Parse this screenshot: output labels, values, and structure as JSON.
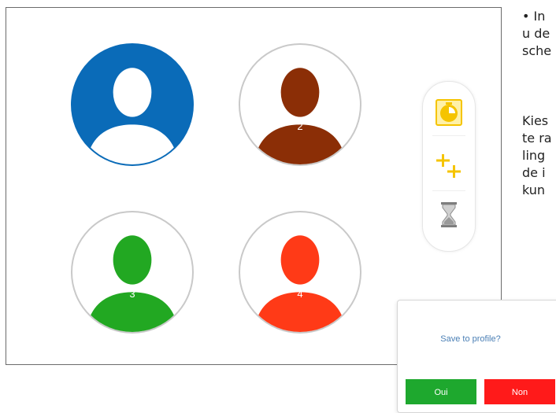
{
  "players": [
    {
      "label": "",
      "bg": "#0a6bb8",
      "body": "#ffffff",
      "ring": "#0a6bb8"
    },
    {
      "label": "2",
      "bg": "#ffffff",
      "body": "#8b2e06",
      "ring": "#c9c9c9"
    },
    {
      "label": "3",
      "bg": "#ffffff",
      "body": "#22a822",
      "ring": "#c9c9c9"
    },
    {
      "label": "4",
      "bg": "#ffffff",
      "body": "#ff3a17",
      "ring": "#c9c9c9"
    }
  ],
  "toolbar": {
    "icons": [
      "clock-icon",
      "double-plus-icon",
      "hourglass-icon"
    ],
    "accent": "#f5c400"
  },
  "side_text": {
    "lines": [
      "• In",
      "u de",
      "sche",
      "",
      "Kies",
      "te ra",
      "ling",
      "de i",
      "kun"
    ]
  },
  "dialog": {
    "title": "Save to profile?",
    "yes_label": "Oui",
    "no_label": "Non",
    "yes_color": "#1ea82e",
    "no_color": "#ff1a1a"
  }
}
